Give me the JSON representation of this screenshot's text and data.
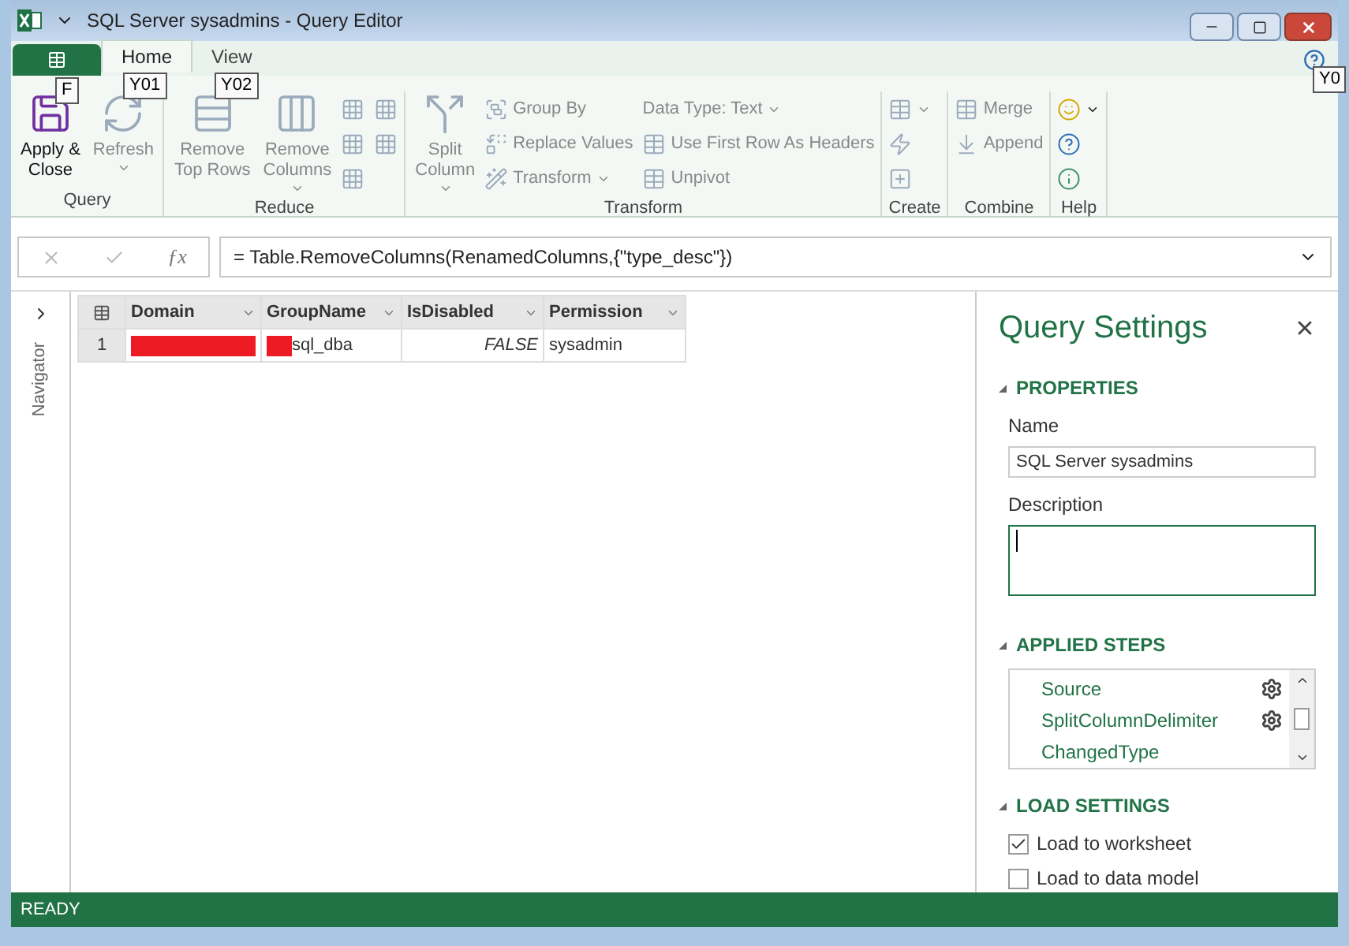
{
  "window": {
    "title": "SQL Server sysadmins - Query Editor"
  },
  "file_tab": {
    "keytip": "F"
  },
  "tabs": [
    {
      "label": "Home",
      "selected": true,
      "keytip": "Y01"
    },
    {
      "label": "View",
      "selected": false,
      "keytip": "Y02"
    }
  ],
  "help_keytip": "Y0",
  "ribbon": {
    "groups": [
      {
        "label": "Query",
        "large": [
          {
            "label": "Apply &\nClose",
            "disabled": false,
            "dropdown": false
          },
          {
            "label": "Refresh",
            "disabled": true,
            "dropdown": true
          }
        ]
      },
      {
        "label": "Reduce",
        "large": [
          {
            "label": "Remove\nTop Rows",
            "disabled": true,
            "dropdown": false
          },
          {
            "label": "Remove\nColumns",
            "disabled": true,
            "dropdown": true
          }
        ],
        "small": [
          {
            "disabled": true,
            "dropdown": false
          },
          {
            "disabled": true,
            "dropdown": false
          },
          {
            "disabled": true,
            "dropdown": false
          },
          {
            "disabled": true,
            "dropdown": false
          },
          {
            "disabled": true,
            "dropdown": false
          }
        ]
      },
      {
        "label": "Transform",
        "large": [
          {
            "label": "Split\nColumn",
            "disabled": true,
            "dropdown": true
          }
        ],
        "small": [
          {
            "label": "Group By",
            "disabled": true,
            "dropdown": false
          },
          {
            "label": "Replace Values",
            "disabled": true,
            "dropdown": false
          },
          {
            "label": "Transform",
            "disabled": true,
            "dropdown": true
          },
          {
            "label": "Data Type: Text",
            "disabled": true,
            "dropdown": true
          },
          {
            "label": "Use First Row As Headers",
            "disabled": true,
            "dropdown": false
          },
          {
            "label": "Unpivot",
            "disabled": true,
            "dropdown": false
          }
        ]
      },
      {
        "label": "Create",
        "small": [
          {
            "disabled": true,
            "dropdown": true
          },
          {
            "disabled": true,
            "dropdown": false
          },
          {
            "disabled": true,
            "dropdown": false
          }
        ]
      },
      {
        "label": "Combine",
        "small": [
          {
            "label": "Merge",
            "disabled": true,
            "dropdown": false
          },
          {
            "label": "Append",
            "disabled": true,
            "dropdown": false
          }
        ]
      },
      {
        "label": "Help",
        "small": [
          {
            "disabled": false,
            "dropdown": true
          },
          {
            "disabled": false,
            "dropdown": false
          },
          {
            "disabled": false,
            "dropdown": false
          }
        ]
      }
    ]
  },
  "formula_bar": {
    "fx_label": "ƒx",
    "formula": "= Table.RemoveColumns(RenamedColumns,{\"type_desc\"})"
  },
  "navigator": {
    "label": "Navigator",
    "expanded": false
  },
  "table": {
    "columns": [
      "Domain",
      "GroupName",
      "IsDisabled",
      "Permission"
    ],
    "rows": [
      {
        "number": "1",
        "cells": [
          {
            "kind": "redacted"
          },
          {
            "kind": "text",
            "text": "sql_dba",
            "redacted_prefix": true
          },
          {
            "kind": "logical",
            "text": "FALSE"
          },
          {
            "kind": "text",
            "text": "sysadmin",
            "redacted_prefix": false
          }
        ]
      }
    ]
  },
  "query_settings": {
    "title": "Query Settings",
    "properties": {
      "heading": "PROPERTIES",
      "name_label": "Name",
      "name_value": "SQL Server sysadmins",
      "description_label": "Description"
    },
    "applied_steps": {
      "heading": "APPLIED STEPS",
      "steps": [
        {
          "label": "Source",
          "settings": true
        },
        {
          "label": "SplitColumnDelimiter",
          "settings": true
        },
        {
          "label": "ChangedType",
          "settings": false
        }
      ]
    },
    "load_settings": {
      "heading": "LOAD SETTINGS",
      "options": [
        {
          "label": "Load to worksheet",
          "checked": true
        },
        {
          "label": "Load to data model",
          "checked": false
        }
      ]
    }
  },
  "status_bar": {
    "text": "READY"
  }
}
